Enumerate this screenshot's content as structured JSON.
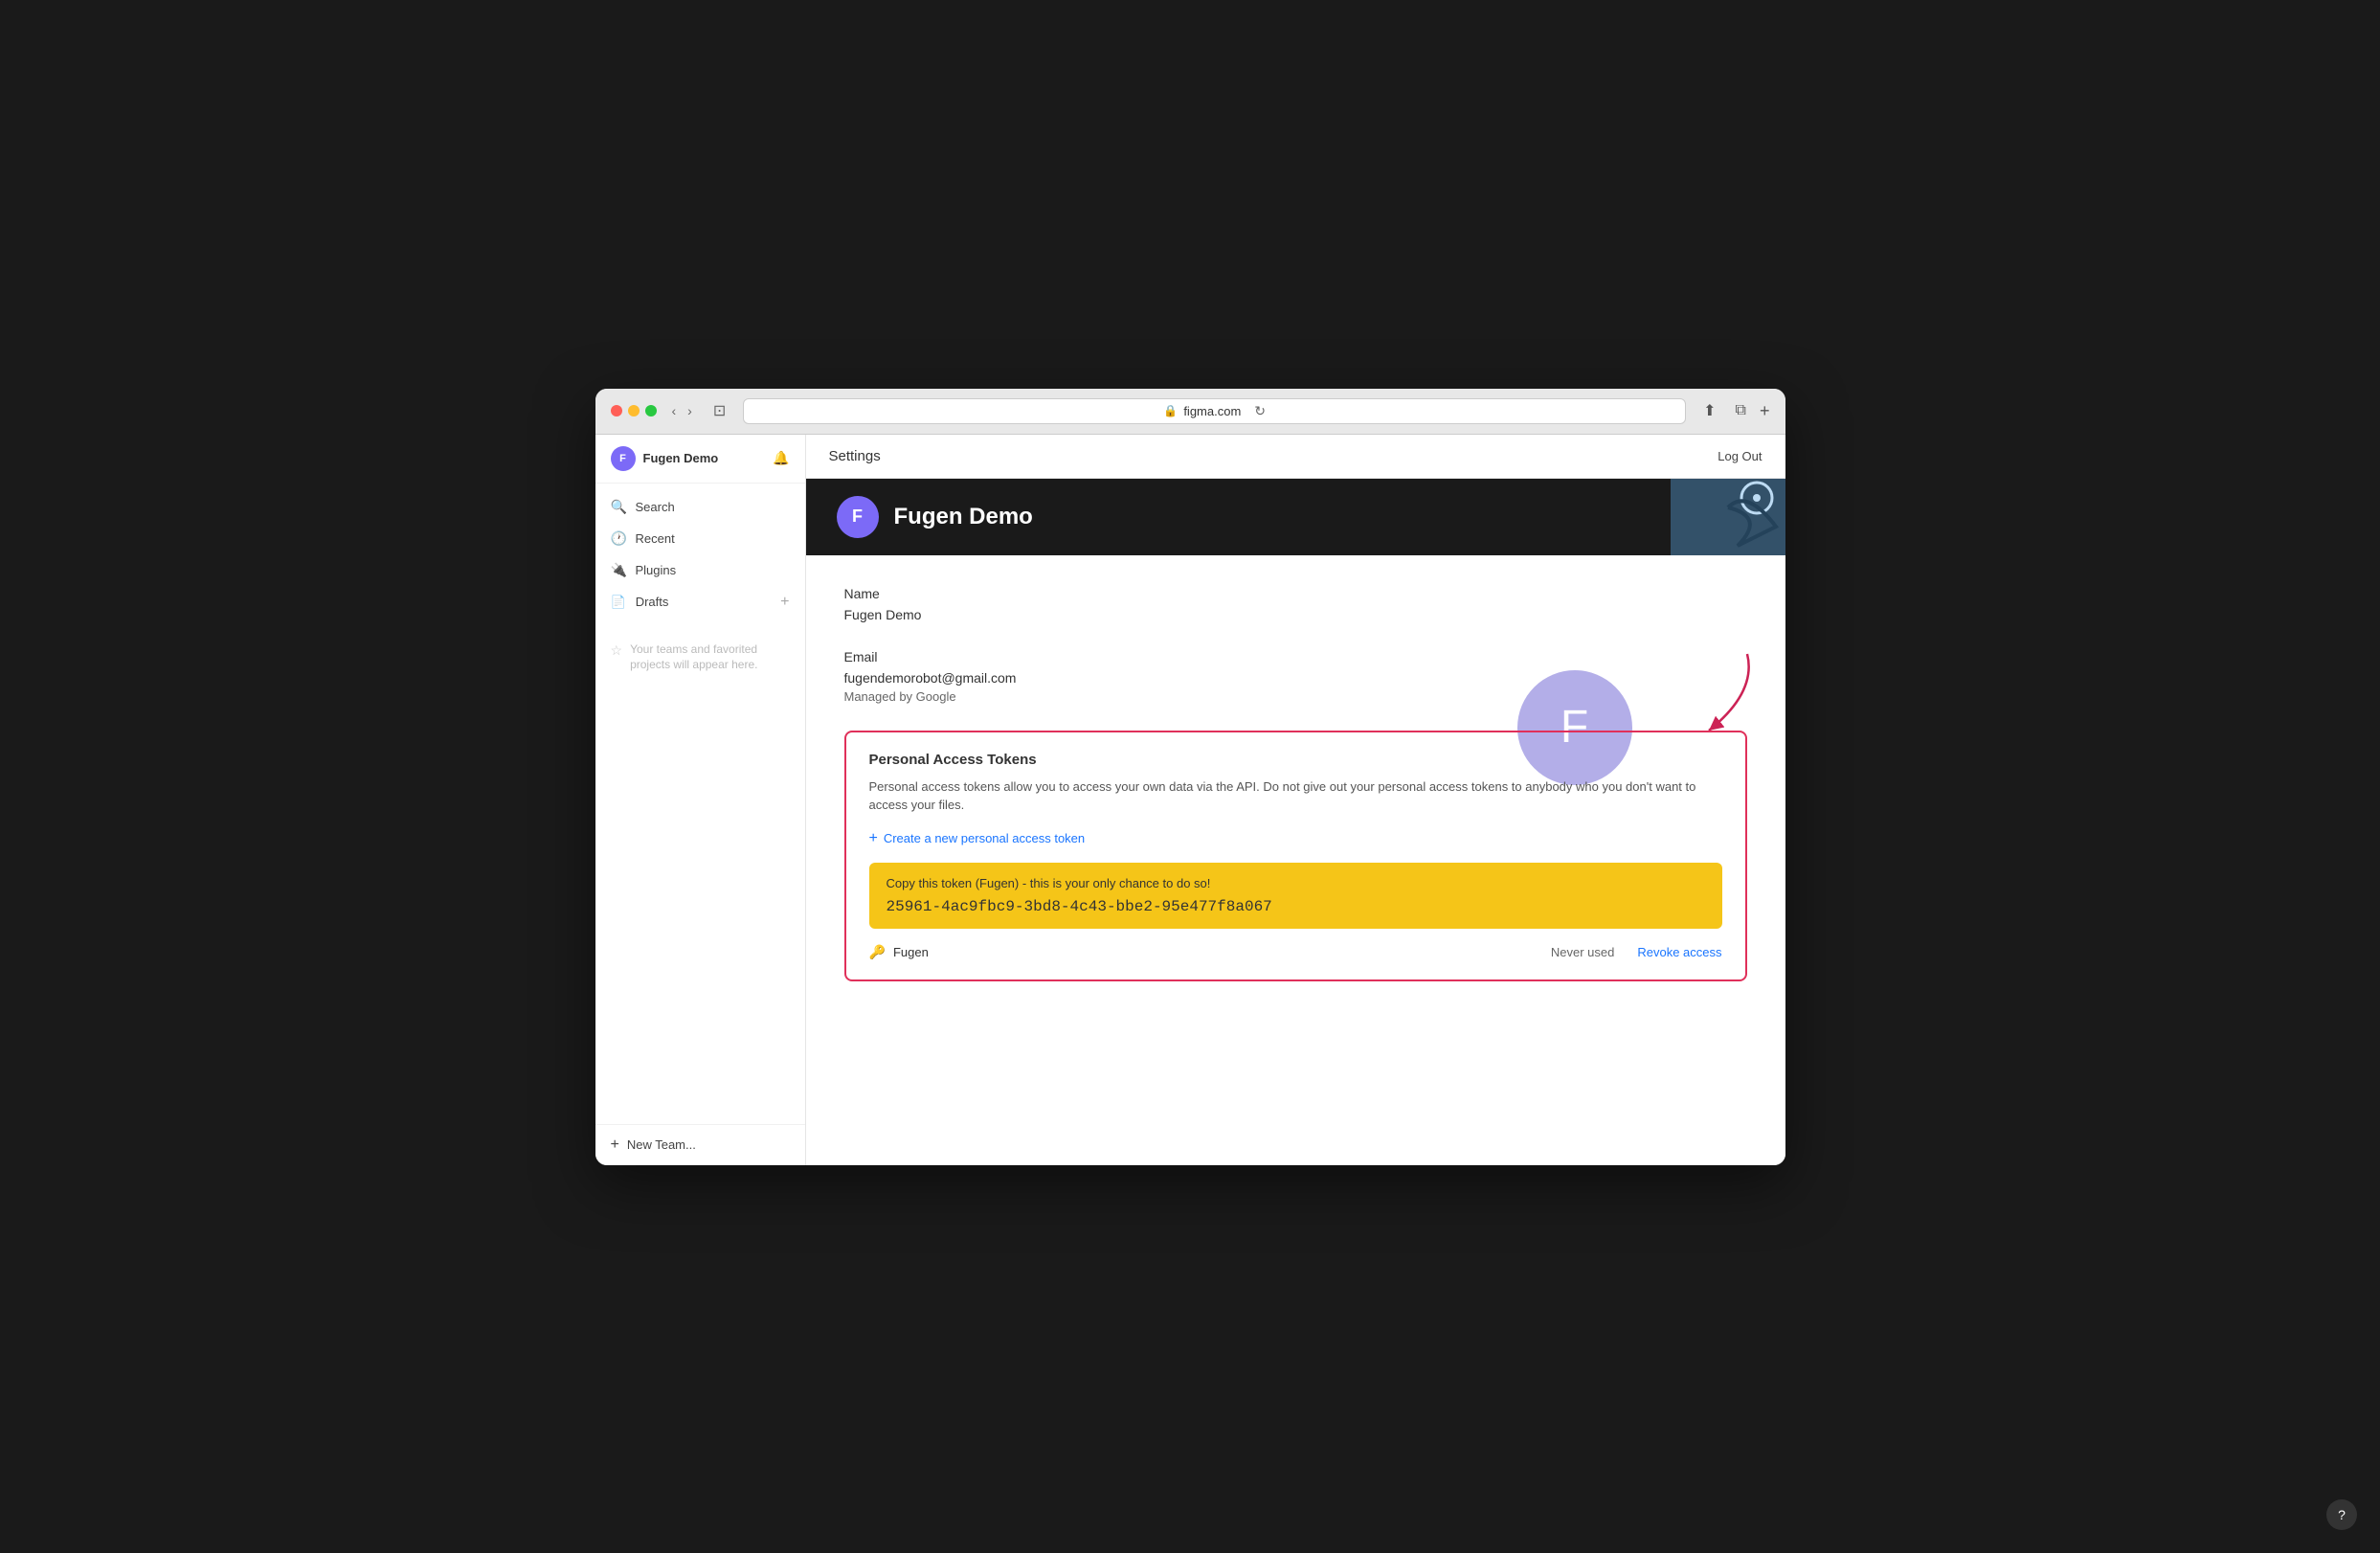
{
  "browser": {
    "url": "figma.com",
    "back_label": "‹",
    "forward_label": "›",
    "sidebar_toggle": "⊡",
    "reload_label": "↻",
    "share_label": "⬆",
    "new_tab_label": "+"
  },
  "sidebar": {
    "user_name": "Fugen Demo",
    "user_initial": "F",
    "bell_icon": "🔔",
    "search_label": "Search",
    "recent_label": "Recent",
    "plugins_label": "Plugins",
    "drafts_label": "Drafts",
    "teams_placeholder": "Your teams and favorited projects will appear here.",
    "new_team_label": "New Team..."
  },
  "topbar": {
    "settings_label": "Settings",
    "logout_label": "Log Out"
  },
  "profile": {
    "banner_name": "Fugen Demo",
    "banner_initial": "F",
    "avatar_initial": "F",
    "name_label": "Name",
    "name_value": "Fugen Demo",
    "email_label": "Email",
    "email_value": "fugendemorobot@gmail.com",
    "email_managed": "Managed by Google"
  },
  "tokens": {
    "section_title": "Personal Access Tokens",
    "description": "Personal access tokens allow you to access your own data via the API. Do not give out your personal access tokens to anybody who you don't want to access your files.",
    "create_link_label": "Create a new personal access token",
    "token_notice": "Copy this token (Fugen) - this is your only chance to do so!",
    "token_value": "25961-4ac9fbc9-3bd8-4c43-bbe2-95e477f8a067",
    "token_name": "Fugen",
    "token_status": "Never used",
    "revoke_label": "Revoke access"
  },
  "help": {
    "label": "?"
  }
}
